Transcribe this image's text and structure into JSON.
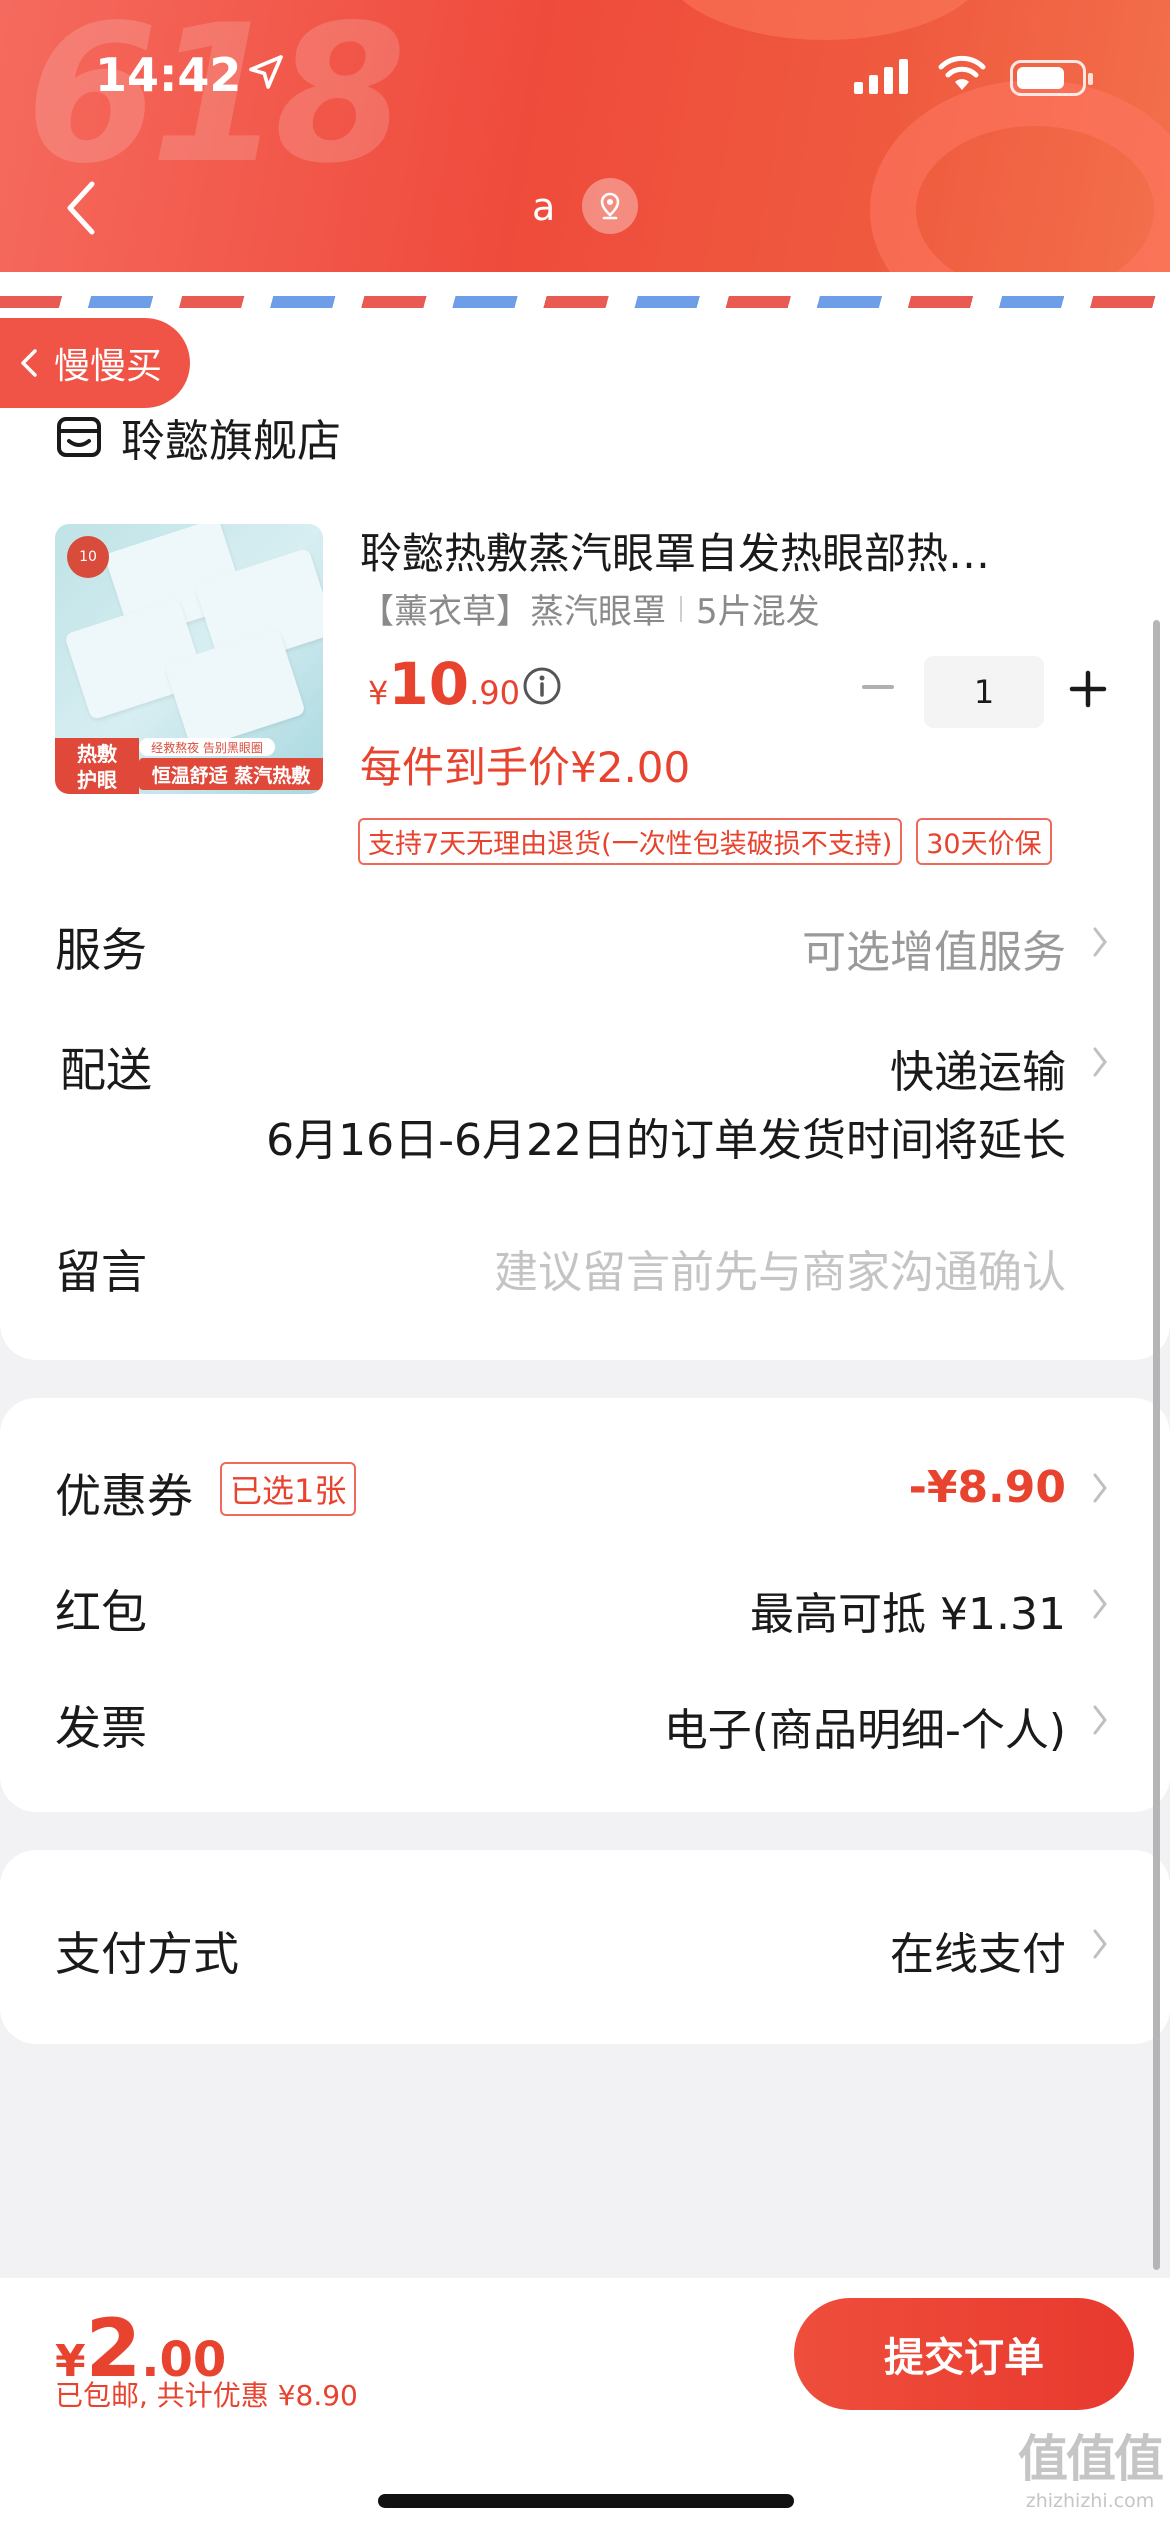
{
  "status_bar": {
    "time": "14:42"
  },
  "nav": {
    "title": "a"
  },
  "slow_buy": {
    "label": "慢慢买"
  },
  "shop": {
    "name": "聆懿旗舰店"
  },
  "product": {
    "title": "聆懿热敷蒸汽眼罩自发热眼部热…",
    "spec_variant": "【薰衣草】蒸汽眼罩",
    "spec_pack": "5片混发",
    "price_yen": "¥",
    "price_int": "10",
    "price_dec": ".90",
    "quantity": "1",
    "unit_price": "每件到手价¥2.00",
    "image_text": {
      "count_badge": "10",
      "tag_a": "热敷\n护眼",
      "tag_b": "恒温舒适 蒸汽热敷",
      "tag_c": "经救熬夜 告别黑眼圈"
    },
    "service_tags": [
      "支持7天无理由退货(一次性包装破损不支持)",
      "30天价保"
    ]
  },
  "service_row": {
    "label": "服务",
    "value": "可选增值服务"
  },
  "delivery_row": {
    "label": "配送",
    "value": "快递运输",
    "note": "6月16日-6月22日的订单发货时间将延长"
  },
  "message_row": {
    "label": "留言",
    "placeholder": "建议留言前先与商家沟通确认"
  },
  "coupon_row": {
    "label": "优惠券",
    "badge": "已选1张",
    "value": "-¥8.90"
  },
  "redpacket_row": {
    "label": "红包",
    "value": "最高可抵 ¥1.31"
  },
  "invoice_row": {
    "label": "发票",
    "value": "电子(商品明细-个人)"
  },
  "payment_row": {
    "label": "支付方式",
    "value": "在线支付"
  },
  "footer": {
    "total_yen": "¥",
    "total_int": "2",
    "total_dec": ".00",
    "note": "已包邮, 共计优惠 ¥8.90",
    "submit_label": "提交订单"
  },
  "watermark": {
    "big": "值值值",
    "small": "zhizhizhi.com"
  },
  "colors": {
    "accent": "#e8432f",
    "header": "#ef4b3c",
    "muted": "#9a9a9a"
  }
}
